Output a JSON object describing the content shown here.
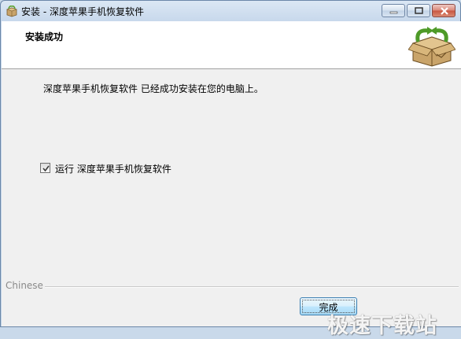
{
  "window": {
    "title": "安装 - 深度苹果手机恢复软件",
    "controls": {
      "minimize_icon": "minimize-icon",
      "maximize_icon": "maximize-icon",
      "close_icon": "close-icon"
    }
  },
  "header": {
    "title": "安装成功",
    "logo_icon": "box-install-icon"
  },
  "main": {
    "message": "深度苹果手机恢复软件 已经成功安装在您的电脑上。",
    "run_checkbox": {
      "label": "运行 深度苹果手机恢复软件",
      "checked": true
    }
  },
  "footer": {
    "language_label": "Chinese",
    "finish_button": "完成"
  },
  "watermark": "极速下载站",
  "colors": {
    "title_bar": "#c6d7eb",
    "client_bg": "#f0f0f0",
    "header_bg": "#ffffff",
    "button_border": "#3c7fb1"
  }
}
